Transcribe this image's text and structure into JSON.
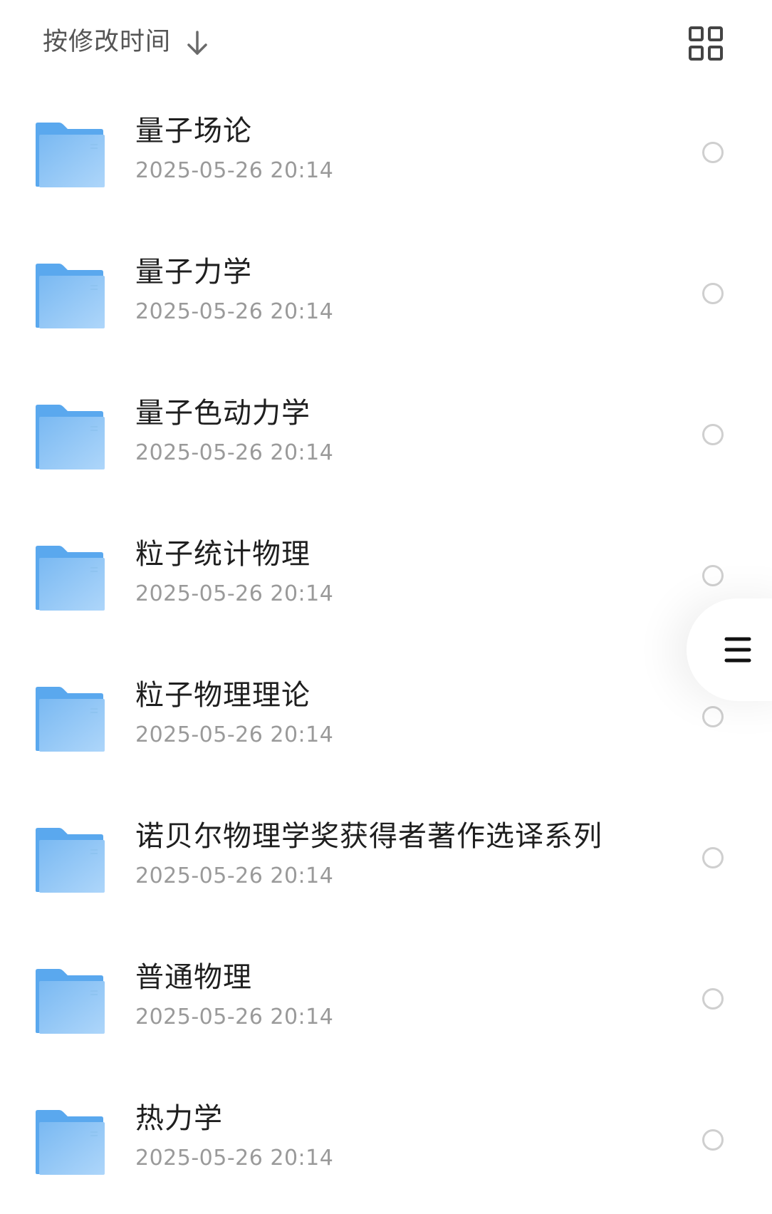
{
  "header": {
    "sort_label": "按修改时间",
    "sort_icon": "arrow-down-icon",
    "view_toggle_icon": "grid-view-icon"
  },
  "folders": [
    {
      "name": "量子场论",
      "date": "2025-05-26 20:14"
    },
    {
      "name": "量子力学",
      "date": "2025-05-26 20:14"
    },
    {
      "name": "量子色动力学",
      "date": "2025-05-26 20:14"
    },
    {
      "name": "粒子统计物理",
      "date": "2025-05-26 20:14"
    },
    {
      "name": "粒子物理理论",
      "date": "2025-05-26 20:14"
    },
    {
      "name": "诺贝尔物理学奖获得者著作选译系列",
      "date": "2025-05-26 20:14"
    },
    {
      "name": "普通物理",
      "date": "2025-05-26 20:14"
    },
    {
      "name": "热力学",
      "date": "2025-05-26 20:14"
    }
  ],
  "floating_button": {
    "icon": "menu-icon"
  },
  "colors": {
    "folder_dark": "#5aa8ee",
    "folder_light": "#a8d4fa",
    "text_primary": "#1f1f1f",
    "text_secondary": "#9a9a9a",
    "radio_border": "#cfcfcf"
  }
}
